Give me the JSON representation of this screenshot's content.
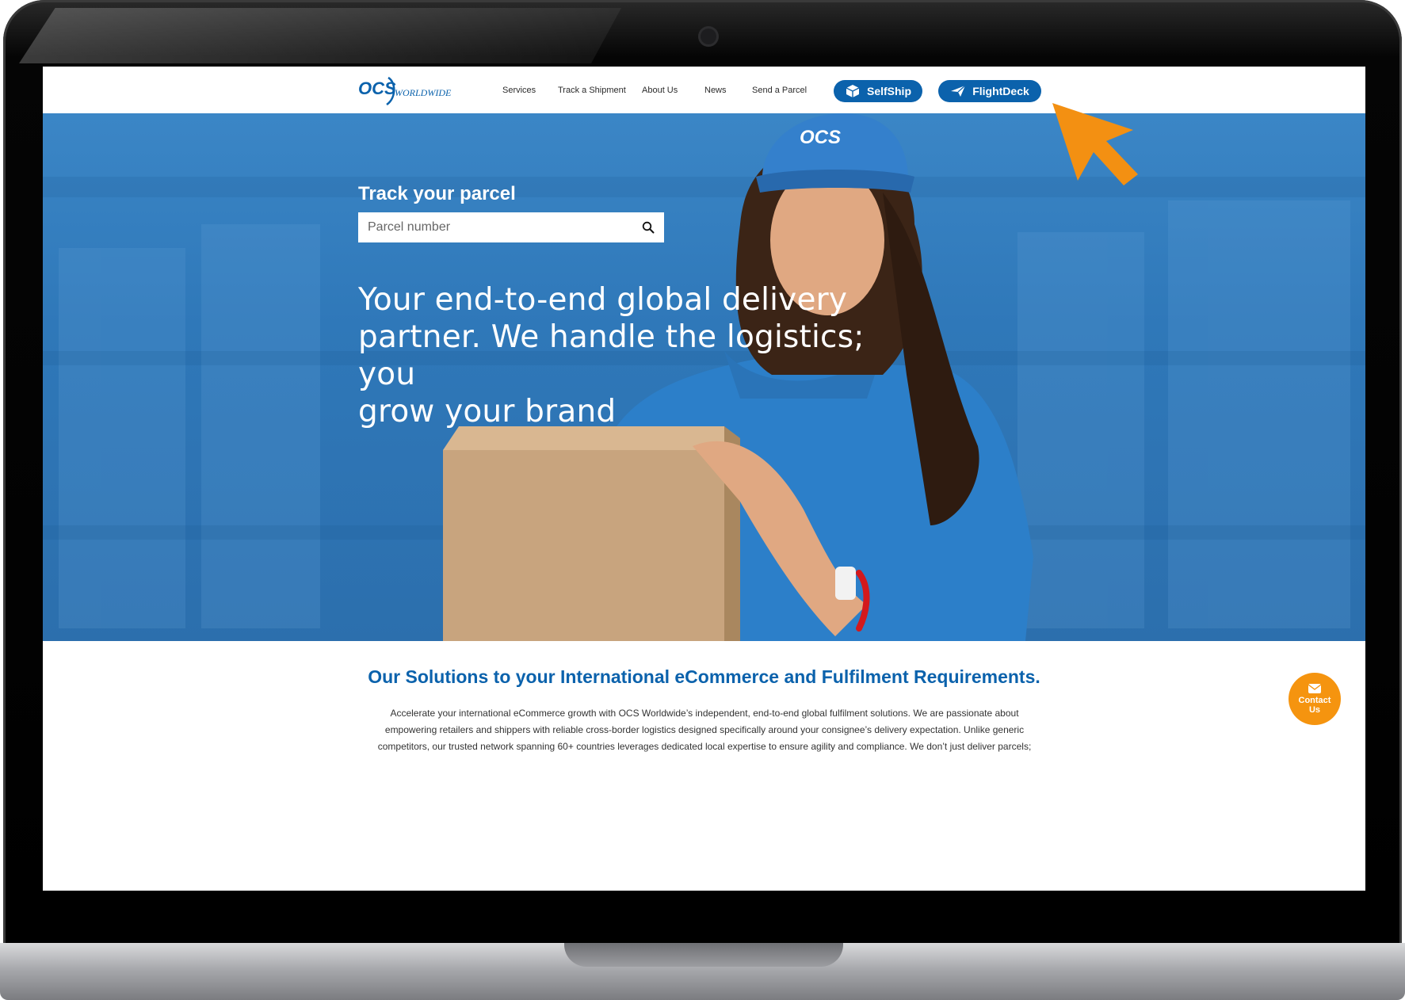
{
  "header": {
    "logo_text": "OCS",
    "logo_subtext": "WORLDWIDE",
    "nav": [
      {
        "label": "Services"
      },
      {
        "label": "Track a Shipment"
      },
      {
        "label": "About Us"
      },
      {
        "label": "News"
      },
      {
        "label": "Send a Parcel"
      }
    ],
    "selfship_label": "SelfShip",
    "flightdeck_label": "FlightDeck",
    "button_color": "#0b62ac"
  },
  "hero": {
    "cap_logo": "OCS",
    "track_title": "Track your parcel",
    "track_placeholder": "Parcel number",
    "headline_lines": [
      "Your end-to-end global delivery",
      "partner. We handle the logistics; you",
      "grow your brand"
    ]
  },
  "solutions": {
    "title": "Our Solutions to your International eCommerce and Fulfilment Requirements.",
    "body_lines": [
      "Accelerate your international eCommerce growth with OCS Worldwide’s independent, end-to-end global fulfilment solutions. We are passionate about",
      "empowering retailers and shippers with reliable cross-border logistics designed specifically around your consignee’s delivery expectation. Unlike generic",
      "competitors, our trusted network spanning 60+ countries leverages dedicated local expertise to ensure agility and compliance. We don’t just deliver parcels;"
    ],
    "title_color": "#0b62ac"
  },
  "contact": {
    "label_line1": "Contact",
    "label_line2": "Us",
    "color": "#f5940f"
  },
  "icons": {
    "search": "search-icon",
    "selfship": "box-icon",
    "flightdeck": "paper-plane-icon",
    "contact": "envelope-icon",
    "cursor": "arrow-cursor-icon"
  }
}
